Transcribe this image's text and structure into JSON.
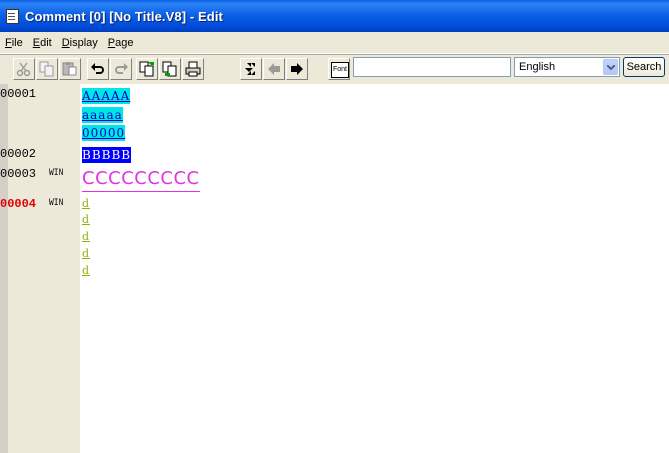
{
  "window": {
    "title": "Comment [0] [No Title.V8] - Edit"
  },
  "menu": [
    {
      "label": "File",
      "key": "F"
    },
    {
      "label": "Edit",
      "key": "E"
    },
    {
      "label": "Display",
      "key": "D"
    },
    {
      "label": "Page",
      "key": "P"
    }
  ],
  "toolbar": {
    "buttons": [
      "cut-icon",
      "copy-icon",
      "paste-icon",
      "undo-icon",
      "redo-icon",
      "import-icon",
      "export-icon",
      "print-icon",
      "jump-icon",
      "back-icon",
      "forward-icon"
    ],
    "font_label": "Font",
    "search_value": "",
    "language": "English",
    "search_label": "Search"
  },
  "document": {
    "rows": [
      {
        "num": "00001",
        "win": "",
        "cells": [
          "AAAAA",
          "aaaaa",
          "00000"
        ]
      },
      {
        "num": "00002",
        "win": "",
        "cells": [
          "BBBBB"
        ]
      },
      {
        "num": "00003",
        "win": "WIN",
        "cells": [
          "CCCCCCCCC"
        ]
      },
      {
        "num": "00004",
        "win": "WIN",
        "cells": [
          "d",
          "d",
          "d",
          "d",
          "d"
        ]
      }
    ]
  },
  "colors": {
    "cyan_bg": "#00e5e5",
    "blue_bg": "#0000ff",
    "magenta": "#e233e2",
    "green": "#88b400",
    "active_line": "#e00000"
  }
}
